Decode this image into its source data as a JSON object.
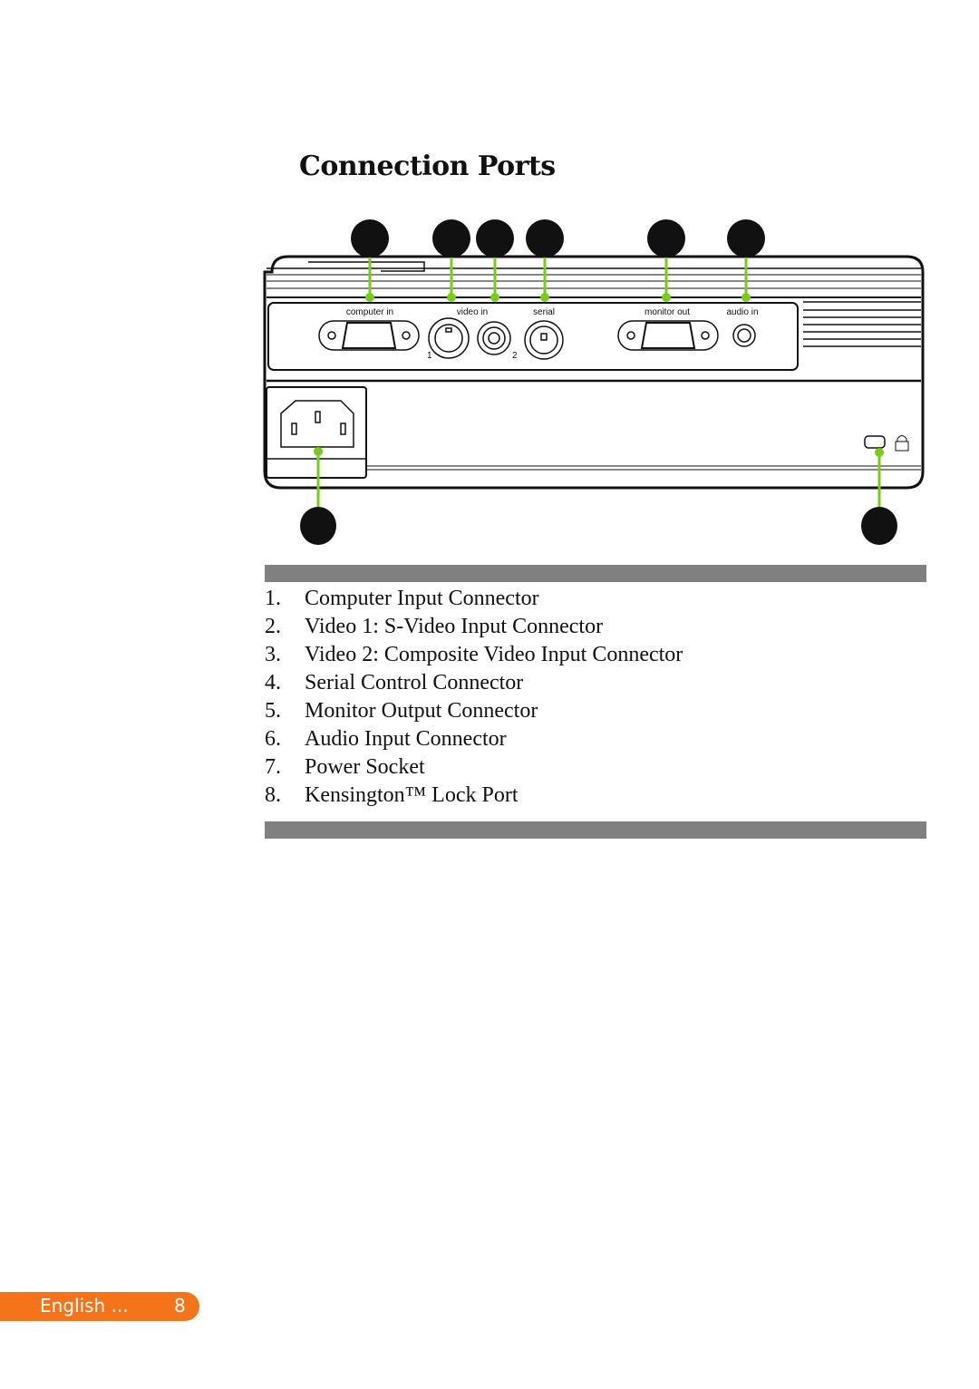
{
  "page": {
    "title": "Connection Ports"
  },
  "diagram": {
    "port_labels": {
      "computer_in": "computer in",
      "video_in": "video in",
      "serial": "serial",
      "monitor_out": "monitor out",
      "audio_in": "audio in",
      "video_1": "1",
      "video_2": "2"
    },
    "callout_color": "#7acc1a",
    "kensington_icon": "kensington-lock-icon"
  },
  "items": [
    {
      "num": "1.",
      "label": "Computer Input Connector"
    },
    {
      "num": "2.",
      "label": "Video 1: S-Video Input Connector"
    },
    {
      "num": "3.",
      "label": "Video 2: Composite Video Input Connector"
    },
    {
      "num": "4.",
      "label": "Serial Control Connector"
    },
    {
      "num": "5.",
      "label": "Monitor Output Connector"
    },
    {
      "num": "6.",
      "label": "Audio Input Connector"
    },
    {
      "num": "7.",
      "label": "Power Socket"
    },
    {
      "num": "8.",
      "label": "Kensington™ Lock Port"
    }
  ],
  "footer": {
    "language": "English ...",
    "page_number": "8",
    "accent": "#f5741a"
  }
}
